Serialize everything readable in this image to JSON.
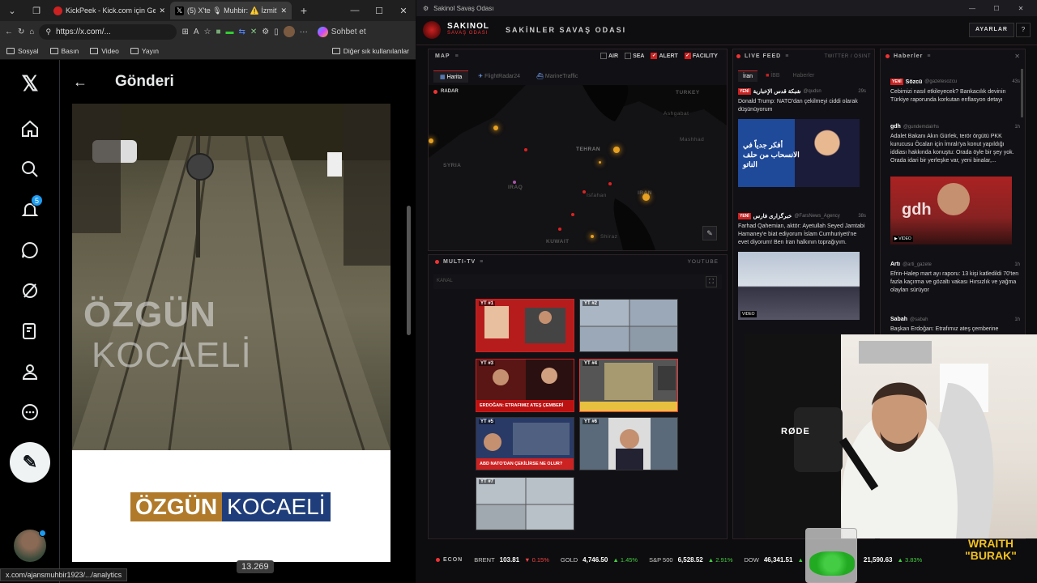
{
  "browser": {
    "tabs": [
      {
        "label": "KickPeek - Kick.com için Gerçek Za",
        "active": false
      },
      {
        "label": "(5) X'te 🎙 Muhbir: ⚠️ İzmit'te b",
        "active": true
      }
    ],
    "url": "https://x.com/...",
    "sohbet_label": "Sohbet et",
    "bookmarks": [
      "Sosyal",
      "Basın",
      "Video",
      "Yayın"
    ],
    "other_bookmarks": "Diğer sık kullanılanlar",
    "status_url": "x.com/ajansmuhbir1923/.../analytics"
  },
  "x": {
    "page_title": "Gönderi",
    "notification_count": "5",
    "video_watermark_left": "ÖZGÜN",
    "video_watermark_right": "KOCAELİ",
    "logo_left": "ÖZGÜN",
    "logo_right": "KOCAELİ",
    "view_count": "13.269"
  },
  "app": {
    "window_title": "Sakinol Savaş Odası",
    "brand": "SAKINOL",
    "brand_sub": "SAVAŞ ODASI",
    "header_title": "SAKİNLER SAVAŞ ODASI",
    "settings_label": "AYARLAR",
    "map": {
      "title": "MAP",
      "toggles": [
        {
          "label": "AIR",
          "checked": false
        },
        {
          "label": "SEA",
          "checked": false
        },
        {
          "label": "ALERT",
          "checked": true
        },
        {
          "label": "FACILITY",
          "checked": true
        }
      ],
      "tabs": [
        "Harita",
        "FlightRadar24",
        "MarineTraffic"
      ],
      "radar_label": "RADAR",
      "labels": [
        "TURKEY",
        "Ashgabat",
        "Mashhad",
        "SYRIA",
        "TEHRAN",
        "IRAQ",
        "Isfahan",
        "IRAN",
        "KUWAIT",
        "Shiraz"
      ]
    },
    "live_feed": {
      "title": "LIVE FEED",
      "source_label": "TWITTER / OSINT",
      "tabs": [
        "İran",
        "İBB",
        "Haberler"
      ],
      "items": [
        {
          "badge": "YENİ",
          "source": "شبكة قدس الإخبارية",
          "handle": "@qudsn",
          "time": "29s",
          "text": "Donald Trump: NATO'dan çekilmeyi ciddi olarak düşünüyorum",
          "image_text": "أفكر جدياً في الانسحاب من حلف الناتو"
        },
        {
          "badge": "YENİ",
          "source": "خبرگزاری فارس",
          "handle": "@FarsNews_Agency",
          "time": "38s",
          "text": "Farhad Qahemian, aktör: Ayetullah Seyed Jamtabi Hamaney'e biat ediyorum İslam Cumhuriyeti'ne evet diyorum! Ben İran halkının toprağıyım.",
          "image_text": "VIDEO"
        }
      ]
    },
    "news": {
      "title": "Haberler",
      "items": [
        {
          "badge": "YENİ",
          "source": "Sözcü",
          "handle": "@gazetesozcu",
          "time": "43s",
          "text": "Cebimizi nasıl etkileyecek? Bankacılık devinin Türkiye raporunda korkutan enflasyon detayı"
        },
        {
          "badge": "",
          "source": "gdh",
          "handle": "@gundemdairhs",
          "time": "1h",
          "text": "Adalet Bakanı Akın Gürlek, terör örgütü PKK kurucusu Öcalan için İmralı'ya konut yapıldığı iddiası hakkında konuştu: Orada öyle bir şey yok. Orada idari bir yerleşke var, yeni binalar,...",
          "image_text": "gdh"
        },
        {
          "badge": "",
          "source": "Artı",
          "handle": "@arti_gazete",
          "time": "1h",
          "text": "Efrin-Halep mart ayı raporu: 13 kişi katledildi 70'ten fazla kaçırma ve gözaltı vakası Hırsızlık ve yağma olayları sürüyor"
        },
        {
          "badge": "",
          "source": "Sabah",
          "handle": "@sabah",
          "time": "1h",
          "text": "Başkan Erdoğan: Etrafımız ateş çemberine"
        }
      ]
    },
    "multitv": {
      "title": "MULTI-TV",
      "source_label": "YOUTUBE",
      "kanal_label": "KANAL",
      "channels": [
        {
          "label": "YT #1",
          "color": "#c22"
        },
        {
          "label": "YT #2",
          "color": "#9aa8b8"
        },
        {
          "label": "YT #3",
          "color": "#b11"
        },
        {
          "label": "YT #4",
          "color": "#a89a70"
        },
        {
          "label": "YT #5",
          "color": "#2a3a66"
        },
        {
          "label": "YT #6",
          "color": "#dcdcdc"
        },
        {
          "label": "YT #7",
          "color": "#b8c0c8"
        }
      ],
      "ch3_caption": "ERDOĞAN: ETRAFIMIZ ATEŞ ÇEMBERİ",
      "ch5_caption": "ABD NATO'DAN ÇEKİLİRSE NE OLUR?"
    },
    "econ": {
      "label": "ECON",
      "items": [
        {
          "name": "BRENT",
          "value": "103.81",
          "change": "▼ 0.15%",
          "dir": "down"
        },
        {
          "name": "GOLD",
          "value": "4,746.50",
          "change": "▲ 1.45%",
          "dir": "up"
        },
        {
          "name": "S&P 500",
          "value": "6,528.52",
          "change": "▲ 2.91%",
          "dir": "up"
        },
        {
          "name": "DOW",
          "value": "46,341.51",
          "change": "▲",
          "dir": "up"
        },
        {
          "name": "",
          "value": "21,590.63",
          "change": "▲ 3.83%",
          "dir": "up"
        }
      ]
    }
  },
  "overlay": {
    "mic_brand": "RØDE",
    "streamer_line1": "WRAITH",
    "streamer_line2": "\"BURAK\""
  },
  "colors": {
    "accent_red": "#e33333",
    "x_blue": "#1d9bf0",
    "gold": "#e8a020"
  }
}
